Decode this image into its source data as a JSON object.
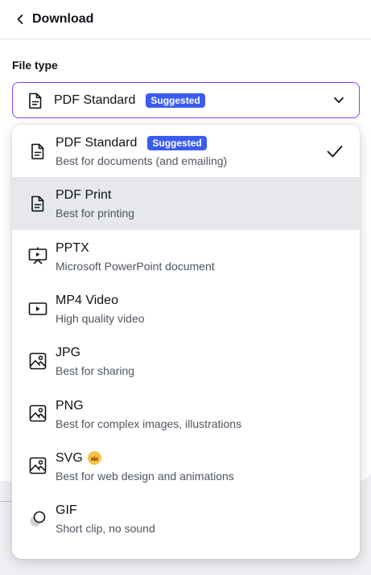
{
  "header": {
    "title": "Download"
  },
  "file_type": {
    "label": "File type",
    "selected_value": "PDF Standard",
    "selected_badge": "Suggested"
  },
  "options": [
    {
      "name": "PDF Standard",
      "badge": "Suggested",
      "desc": "Best for documents (and emailing)",
      "icon": "document-icon",
      "selected": true
    },
    {
      "name": "PDF Print",
      "desc": "Best for printing",
      "icon": "document-icon",
      "hovered": true
    },
    {
      "name": "PPTX",
      "desc": "Microsoft PowerPoint document",
      "icon": "presentation-icon"
    },
    {
      "name": "MP4 Video",
      "desc": "High quality video",
      "icon": "video-icon"
    },
    {
      "name": "JPG",
      "desc": "Best for sharing",
      "icon": "image-icon"
    },
    {
      "name": "PNG",
      "desc": "Best for complex images, illustrations",
      "icon": "image-icon"
    },
    {
      "name": "SVG",
      "desc": "Best for web design and animations",
      "icon": "image-icon",
      "premium": true
    },
    {
      "name": "GIF",
      "desc": "Short clip, no sound",
      "icon": "gif-icon"
    }
  ],
  "colors": {
    "accent": "#8b3dff",
    "badge": "#3a5cf0",
    "hover": "#e6e8eb",
    "premium": "#f7c44a"
  }
}
